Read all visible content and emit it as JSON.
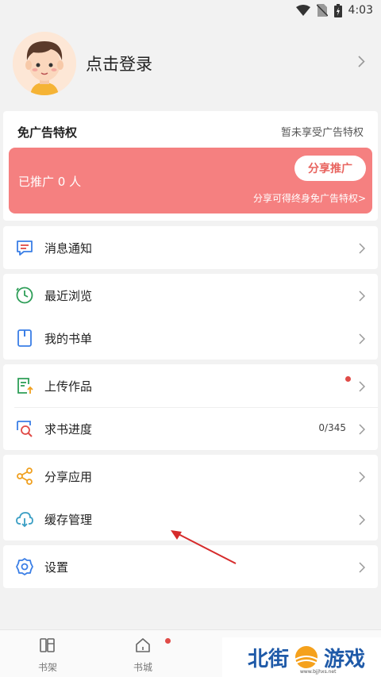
{
  "status_bar": {
    "time": "4:03"
  },
  "profile": {
    "login_label": "点击登录"
  },
  "ad_card": {
    "title": "免广告特权",
    "status": "暂未享受广告特权",
    "promo_count": "已推广 0 人",
    "share_button": "分享推广",
    "promo_subtext": "分享可得终身免广告特权>"
  },
  "menu": {
    "messages": "消息通知",
    "recent": "最近浏览",
    "booklist": "我的书单",
    "upload": "上传作品",
    "request": "求书进度",
    "request_count": "0/345",
    "share_app": "分享应用",
    "cache": "缓存管理",
    "settings": "设置"
  },
  "bottom_nav": {
    "bookshelf": "书架",
    "bookstore": "书城"
  },
  "watermark": {
    "text_left": "北街",
    "text_right": "游戏",
    "url": "www.bjjhxs.net"
  },
  "colors": {
    "promo_bg": "#f58080",
    "accent_red": "#e04b47",
    "annotation_arrow": "#d62b2b"
  }
}
